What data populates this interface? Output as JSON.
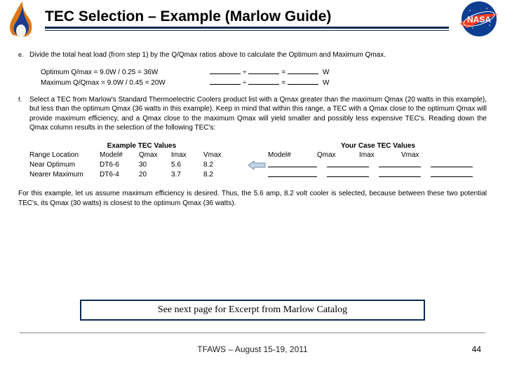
{
  "header": {
    "title": "TEC Selection – Example (Marlow Guide)"
  },
  "steps": {
    "e": {
      "letter": "e.",
      "text": "Divide the total heat load (from step 1) by the Q/Qmax ratios above to calculate the Optimum and Maximum Qmax.",
      "eq1": "Optimum Q/max = 9.0W / 0.25 = 36W",
      "eq2": "Maximum Q/Qmax = 9.0W / 0.45 = 20W",
      "fill_op": "÷",
      "fill_eq": "=",
      "fill_unit": "W"
    },
    "f": {
      "letter": "f.",
      "text": "Select a TEC from Marlow's Standard Thermoelectric Coolers product list with a Qmax greater than the maximum Qmax (20 watts in this example), but less than the optimum Qmax (36 watts in this example). Keep in mind that within this range, a TEC with a Qmax close to the optimum Qmax will provide maximum efficiency, and a Qmax close to the maximum Qmax will yield smaller and possibly less expensive TEC's.  Reading down the Qmax column results in the selection of the following TEC's:"
    }
  },
  "table": {
    "group_a": "Example TEC Values",
    "group_b": "Your Case TEC Values",
    "headers": {
      "range": "Range Location",
      "model": "Model#",
      "qmax": "Qmax",
      "imax": "Imax",
      "vmax": "Vmax"
    },
    "rows": [
      {
        "range": "Near Optimum",
        "model": "DT6-6",
        "qmax": "30",
        "imax": "5.6",
        "vmax": "8.2"
      },
      {
        "range": "Nearer Maximum",
        "model": "DT6-4",
        "qmax": "20",
        "imax": "3.7",
        "vmax": "8.2"
      }
    ]
  },
  "para": "For this example, let us assume maximum efficiency is desired.  Thus, the 5.6 amp, 8.2 volt cooler is selected, because between these two potential TEC's, its Qmax (30 watts) is closest to the optimum Qmax (36 watts).",
  "callout": "See next page for Excerpt from Marlow Catalog",
  "footer": {
    "text": "TFAWS – August 15-19, 2011",
    "page": "44"
  }
}
